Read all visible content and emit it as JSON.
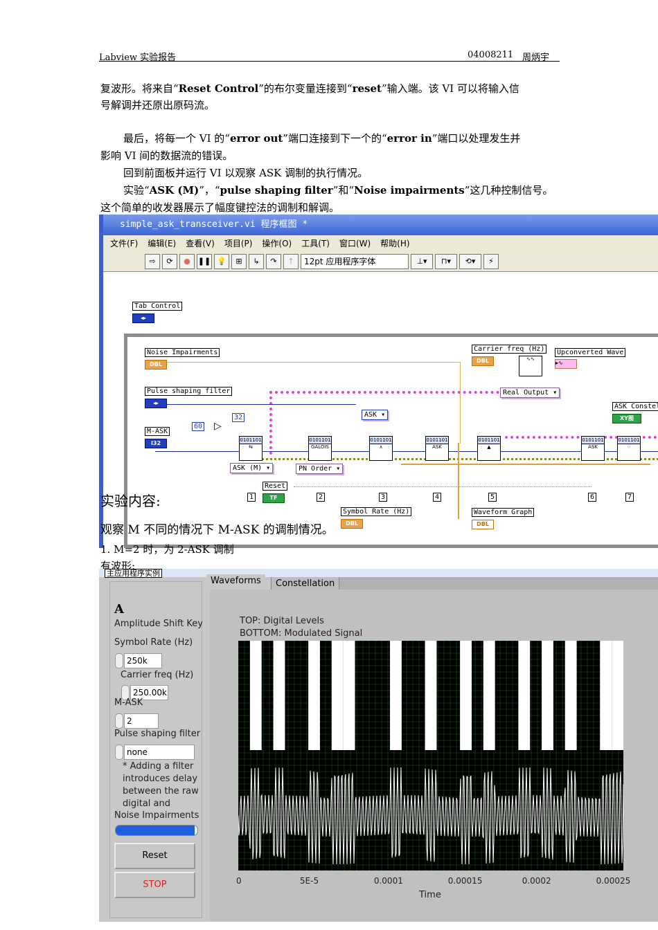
{
  "header": {
    "left": "Labview  实验报告",
    "right_id": "04008211",
    "right_name": "周炳宇"
  },
  "paragraphs": {
    "p1a": "复波形。将来自“",
    "p1b": "Reset Control",
    "p1c": "”的布尔变量连接到“",
    "p1d": "reset",
    "p1e": "”输入端。该 VI 可以将输入信",
    "p1f": "号解调并还原出原码流。",
    "p2a": "最后，将每一个 VI 的“",
    "p2b": "error out",
    "p2c": "”端口连接到下一个的“",
    "p2d": "error in",
    "p2e": "”端口以处理发生并",
    "p2f": "影响 VI 间的数据流的错误。",
    "p3": "回到前面板并运行 VI 以观察 ASK 调制的执行情况。",
    "p4a": "实验“",
    "p4b": "ASK (M)",
    "p4c": "”，“",
    "p4d": "pulse shaping filter",
    "p4e": "”和“",
    "p4f": "Noise impairments",
    "p4g": "”这几种控制信号。",
    "p5": "这个简单的收发器展示了幅度键控法的调制和解调。"
  },
  "overlay": {
    "section": "实验内容:",
    "line1": "观察 M 不同的情况下 M-ASK 的调制情况。",
    "line2": "1.    M=2 时，为 2-ASK 调制",
    "line3": "有波形:"
  },
  "block_diagram": {
    "title": "simple_ask_transceiver.vi 程序框图 *",
    "menu": [
      "文件(F)",
      "编辑(E)",
      "查看(V)",
      "项目(P)",
      "操作(O)",
      "工具(T)",
      "窗口(W)",
      "帮助(H)"
    ],
    "font_select": "12pt 应用程序字体",
    "labels": {
      "tab_control": "Tab Control",
      "noise": "Noise Impairments",
      "pulse": "Pulse shaping filter",
      "mask": "M-ASK",
      "carrier": "Carrier freq (Hz)",
      "upconv": "Upconverted Wave",
      "real_output": "Real Output",
      "ask_const": "ASK Constel",
      "symbol_rate": "Symbol Rate (Hz)",
      "waveform_graph": "Waveform Graph",
      "reset": "Reset",
      "ask_m": "ASK (M)",
      "pn_order": "PN Order",
      "ask_ring": "ASK"
    },
    "terminals": {
      "dbl": "DBL",
      "i32": "I32",
      "tf": "TF",
      "xy": "XY图"
    },
    "constants": {
      "c60": "60",
      "c32": "32"
    },
    "vi_label": "0101101",
    "frames": [
      "1",
      "2",
      "3",
      "4",
      "5",
      "6",
      "7"
    ]
  },
  "front_panel": {
    "tab_strip": "主应用程序实例",
    "tabs": [
      "Waveforms",
      "Constellation"
    ],
    "heading": "Amplitude Shift Keyir",
    "symbol_rate_label": "Symbol Rate (Hz)",
    "symbol_rate": "250k",
    "carrier_label": "Carrier freq (Hz)",
    "carrier": "250.00k",
    "mask_label": "M-ASK",
    "mask": "2",
    "pulse_label": "Pulse shaping filter",
    "pulse": "none",
    "note": [
      "* Adding a filter",
      "introduces delay",
      "between the raw",
      "digital and"
    ],
    "noise_label": "Noise Impairments",
    "noise_value": 0.97,
    "reset": "Reset",
    "stop": "STOP"
  },
  "chart_data": {
    "type": "line",
    "title": "TOP: Digital Levels",
    "subtitle": "BOTTOM: Modulated Signal",
    "xlabel": "Time",
    "ylabel": "",
    "xlim": [
      0,
      0.00026
    ],
    "x_ticks": [
      "0",
      "5E-5",
      "0.0001",
      "0.00015",
      "0.0002",
      "0.00025"
    ],
    "digital_levels": [
      0,
      1,
      0,
      1,
      0,
      0,
      1,
      0,
      1,
      1,
      0,
      0,
      0,
      1,
      0,
      0,
      1,
      0,
      0,
      1,
      0,
      1,
      0,
      0,
      1,
      0,
      1,
      0,
      1,
      0,
      0,
      1,
      1
    ],
    "grid": true,
    "colors": {
      "bg": "#000000",
      "grid": "#1e5a1e",
      "trace": "#ffffff"
    }
  }
}
